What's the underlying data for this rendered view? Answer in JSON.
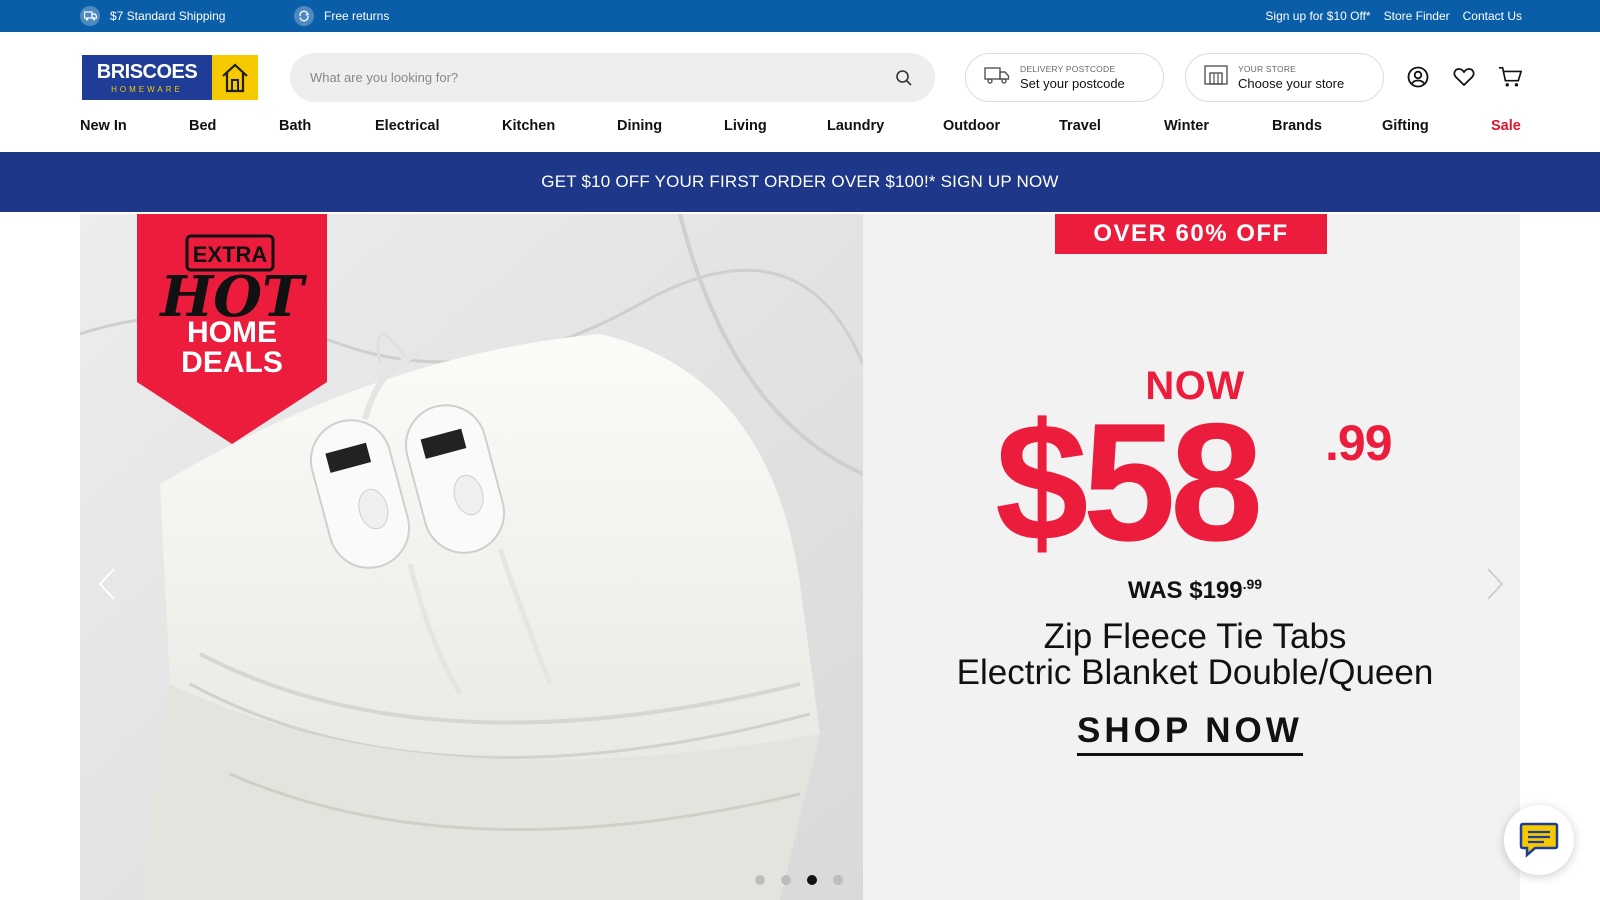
{
  "topbar": {
    "shipping": "$7 Standard Shipping",
    "returns": "Free returns",
    "links": [
      "Sign up for $10 Off*",
      "Store Finder",
      "Contact Us"
    ]
  },
  "header": {
    "logo_main": "BRISCOES",
    "logo_sub": "HOMEWARE",
    "search_placeholder": "What are you looking for?",
    "delivery_caption": "DELIVERY POSTCODE",
    "delivery_value": "Set your postcode",
    "store_caption": "YOUR STORE",
    "store_value": "Choose your store"
  },
  "nav": [
    "New In",
    "Bed",
    "Bath",
    "Electrical",
    "Kitchen",
    "Dining",
    "Living",
    "Laundry",
    "Outdoor",
    "Travel",
    "Winter",
    "Brands",
    "Gifting",
    "Sale"
  ],
  "promo": "GET $10 OFF YOUR FIRST ORDER OVER $100!* SIGN UP NOW",
  "hero": {
    "badge_extra": "EXTRA",
    "badge_hot": "HOT",
    "badge_home": "HOME",
    "badge_deals": "DEALS",
    "over_off": "OVER 60% OFF",
    "now": "NOW",
    "price_dollars": "$58",
    "price_cents": ".99",
    "was_label": "WAS $199",
    "was_cents": ".99",
    "product_line1": "Zip Fleece Tie Tabs",
    "product_line2": "Electric Blanket Double/Queen",
    "cta": "SHOP NOW",
    "slides_total": 4,
    "active_slide": 3
  },
  "colors": {
    "topbar": "#0a5ea8",
    "brand_blue": "#1f3c96",
    "brand_yellow": "#f6c900",
    "promo_bar": "#1f3788",
    "sale_red": "#e0112b",
    "deal_red": "#ec1c3d"
  }
}
